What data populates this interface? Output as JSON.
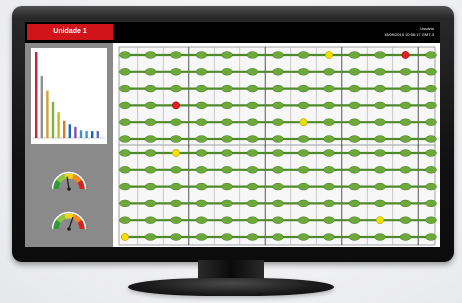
{
  "header": {
    "unit_tab": "Unidade 1",
    "user_label": "Usuário",
    "datetime": "15/09/2015 10:56:17 GMT-3"
  },
  "colors": {
    "brand_red": "#d0141a",
    "ok": "#6ea83a",
    "warning": "#f0e000",
    "alarm": "#e41d1d"
  },
  "sidebar": {
    "bar_chart": {
      "type": "bar",
      "values": [
        100,
        72,
        55,
        42,
        30,
        20,
        16,
        13,
        9,
        8,
        8,
        8
      ],
      "colors": [
        "#d0203a",
        "#909090",
        "#d4a030",
        "#80b040",
        "#c8b820",
        "#d87830",
        "#2060c0",
        "#8050b0",
        "#4090d0",
        "#30a0c0",
        "#2060b0",
        "#5070c0"
      ]
    },
    "gauges": [
      {
        "name": "gauge-1",
        "needle_fraction": 0.45
      },
      {
        "name": "gauge-2",
        "needle_fraction": 0.6
      }
    ]
  },
  "sensor_grid": {
    "columns": 13,
    "rows": [
      {
        "section": 1
      },
      {
        "section": 1
      },
      {
        "section": 1
      },
      {
        "section": 1
      },
      {
        "section": 1
      },
      {
        "section": 1
      },
      {
        "section": 2
      },
      {
        "section": 2
      },
      {
        "section": 2
      },
      {
        "section": 2
      },
      {
        "section": 2
      },
      {
        "section": 2
      }
    ],
    "alerts": [
      {
        "row": 0,
        "col": 8,
        "status": "warning"
      },
      {
        "row": 0,
        "col": 11,
        "status": "alarm"
      },
      {
        "row": 3,
        "col": 2,
        "status": "alarm"
      },
      {
        "row": 4,
        "col": 7,
        "status": "warning"
      },
      {
        "row": 6,
        "col": 2,
        "status": "warning"
      },
      {
        "row": 10,
        "col": 10,
        "status": "warning"
      },
      {
        "row": 11,
        "col": 0,
        "status": "warning"
      }
    ]
  }
}
